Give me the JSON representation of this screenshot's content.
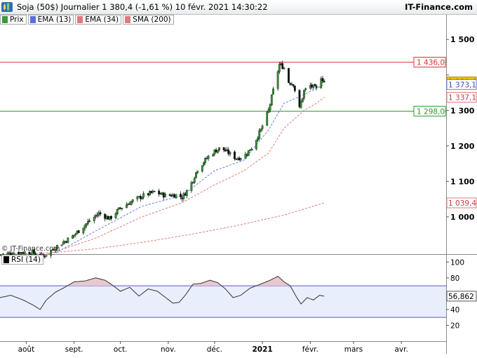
{
  "window": {
    "title": "Soja (50$) Journalier 1 380,4 (-1,61 %) 10 févr. 2021 14:30:22",
    "brand": "IT-Finance.com",
    "copyright": "© IT-Finance.com",
    "logo_icon": "candlestick-logo-icon"
  },
  "legend": [
    {
      "label": "Prix",
      "color": "#3a9a3a"
    },
    {
      "label": "EMA (13)",
      "color": "#5b6ee0"
    },
    {
      "label": "EMA (34)",
      "color": "#e07a7a"
    },
    {
      "label": "SMA (200)",
      "color": "#e07a7a"
    }
  ],
  "rsi_legend": {
    "label": "RSI (14)",
    "color": "#000000"
  },
  "colors": {
    "up": "#2e9a2e",
    "down": "#111111",
    "ema13": "#6a7be8",
    "ema34": "#e07a7a",
    "sma200": "#e07a7a",
    "resistance": "#e03030",
    "support": "#2e9a2e",
    "price_badge": "#f2c200",
    "rsi_fill": "#e9eefc",
    "rsi_over": "#e8c8d0",
    "rsi_line": "#333333"
  },
  "chart_data": [
    {
      "type": "candlestick",
      "title": "Soja (50$) Journalier",
      "x_type": "date",
      "x_tick_labels": [
        "août",
        "sept.",
        "oct.",
        "nov.",
        "déc.",
        "2021",
        "févr.",
        "mars",
        "avr."
      ],
      "x_tick_dates": [
        "2020-08-01",
        "2020-09-01",
        "2020-10-01",
        "2020-11-01",
        "2020-12-01",
        "2021-01-01",
        "2021-02-01",
        "2021-03-01",
        "2021-04-01"
      ],
      "x_range": [
        "2020-07-15",
        "2021-04-30"
      ],
      "ylim": [
        895,
        1540
      ],
      "y_ticks": [
        1000,
        1100,
        1200,
        1300,
        1400,
        1500
      ],
      "y_tick_labels": [
        "1 000",
        "1 100",
        "1 200",
        "1 300",
        "",
        "1 500"
      ],
      "price_path": [
        [
          "2020-07-15",
          893
        ],
        [
          "2020-07-25",
          900
        ],
        [
          "2020-08-05",
          900
        ],
        [
          "2020-08-12",
          888
        ],
        [
          "2020-08-20",
          915
        ],
        [
          "2020-08-31",
          945
        ],
        [
          "2020-09-10",
          985
        ],
        [
          "2020-09-17",
          1010
        ],
        [
          "2020-09-24",
          995
        ],
        [
          "2020-10-01",
          1025
        ],
        [
          "2020-10-09",
          1045
        ],
        [
          "2020-10-16",
          1060
        ],
        [
          "2020-10-23",
          1070
        ],
        [
          "2020-10-30",
          1060
        ],
        [
          "2020-11-06",
          1062
        ],
        [
          "2020-11-10",
          1055
        ],
        [
          "2020-11-15",
          1085
        ],
        [
          "2020-11-20",
          1135
        ],
        [
          "2020-11-27",
          1170
        ],
        [
          "2020-12-01",
          1185
        ],
        [
          "2020-12-05",
          1195
        ],
        [
          "2020-12-10",
          1180
        ],
        [
          "2020-12-15",
          1165
        ],
        [
          "2020-12-20",
          1170
        ],
        [
          "2020-12-25",
          1195
        ],
        [
          "2020-12-31",
          1245
        ],
        [
          "2021-01-05",
          1300
        ],
        [
          "2021-01-09",
          1375
        ],
        [
          "2021-01-12",
          1430
        ],
        [
          "2021-01-15",
          1420
        ],
        [
          "2021-01-18",
          1380
        ],
        [
          "2021-01-21",
          1375
        ],
        [
          "2021-01-25",
          1305
        ],
        [
          "2021-01-28",
          1355
        ],
        [
          "2021-02-01",
          1370
        ],
        [
          "2021-02-05",
          1360
        ],
        [
          "2021-02-08",
          1395
        ],
        [
          "2021-02-10",
          1380
        ]
      ],
      "ema13": [
        [
          "2020-08-20",
          898
        ],
        [
          "2020-09-15",
          960
        ],
        [
          "2020-10-15",
          1030
        ],
        [
          "2020-11-10",
          1060
        ],
        [
          "2020-12-01",
          1130
        ],
        [
          "2020-12-20",
          1160
        ],
        [
          "2021-01-05",
          1245
        ],
        [
          "2021-01-15",
          1320
        ],
        [
          "2021-01-28",
          1345
        ],
        [
          "2021-02-05",
          1362
        ],
        [
          "2021-02-10",
          1373.1
        ]
      ],
      "ema34": [
        [
          "2020-08-15",
          895
        ],
        [
          "2020-09-15",
          940
        ],
        [
          "2020-10-15",
          1000
        ],
        [
          "2020-11-10",
          1040
        ],
        [
          "2020-12-01",
          1090
        ],
        [
          "2020-12-20",
          1130
        ],
        [
          "2021-01-05",
          1180
        ],
        [
          "2021-01-15",
          1250
        ],
        [
          "2021-01-28",
          1300
        ],
        [
          "2021-02-05",
          1320
        ],
        [
          "2021-02-10",
          1337.1
        ]
      ],
      "sma200": [
        [
          "2020-07-20",
          895
        ],
        [
          "2020-08-15",
          898
        ],
        [
          "2020-09-15",
          910
        ],
        [
          "2020-10-15",
          928
        ],
        [
          "2020-11-15",
          950
        ],
        [
          "2020-12-15",
          975
        ],
        [
          "2021-01-15",
          1005
        ],
        [
          "2021-02-10",
          1039.4
        ]
      ],
      "resistance_level": 1436.0,
      "resistance_label": "1 436,0",
      "support_level": 1298.0,
      "support_label": "1 298,0",
      "last_price": 1380.4,
      "last_price_label": "1 380,4",
      "ema13_last_label": "1 373,1",
      "ema34_last_label": "1 337,1",
      "sma200_last_label": "1 039,4"
    },
    {
      "type": "line",
      "title": "RSI (14)",
      "ylim": [
        0,
        110
      ],
      "y_ticks": [
        20,
        40,
        60,
        80,
        100
      ],
      "y_tick_labels": [
        "20",
        "40",
        "",
        "80",
        "100"
      ],
      "overbought": 70,
      "oversold": 30,
      "last_value": 56.862,
      "last_value_label": "56,862",
      "rsi_path": [
        [
          "2020-07-15",
          55
        ],
        [
          "2020-07-22",
          58
        ],
        [
          "2020-07-30",
          52
        ],
        [
          "2020-08-06",
          45
        ],
        [
          "2020-08-10",
          40
        ],
        [
          "2020-08-14",
          52
        ],
        [
          "2020-08-20",
          62
        ],
        [
          "2020-08-26",
          68
        ],
        [
          "2020-09-01",
          75
        ],
        [
          "2020-09-08",
          76
        ],
        [
          "2020-09-15",
          80
        ],
        [
          "2020-09-21",
          77
        ],
        [
          "2020-09-25",
          72
        ],
        [
          "2020-10-01",
          63
        ],
        [
          "2020-10-07",
          68
        ],
        [
          "2020-10-13",
          57
        ],
        [
          "2020-10-19",
          66
        ],
        [
          "2020-10-25",
          63
        ],
        [
          "2020-10-31",
          54
        ],
        [
          "2020-11-04",
          48
        ],
        [
          "2020-11-08",
          49
        ],
        [
          "2020-11-12",
          58
        ],
        [
          "2020-11-17",
          72
        ],
        [
          "2020-11-22",
          73
        ],
        [
          "2020-11-28",
          77
        ],
        [
          "2020-12-03",
          74
        ],
        [
          "2020-12-08",
          66
        ],
        [
          "2020-12-13",
          55
        ],
        [
          "2020-12-18",
          58
        ],
        [
          "2020-12-24",
          67
        ],
        [
          "2021-01-01",
          73
        ],
        [
          "2021-01-06",
          77
        ],
        [
          "2021-01-11",
          82
        ],
        [
          "2021-01-15",
          75
        ],
        [
          "2021-01-19",
          70
        ],
        [
          "2021-01-23",
          56
        ],
        [
          "2021-01-26",
          47
        ],
        [
          "2021-01-30",
          55
        ],
        [
          "2021-02-03",
          52
        ],
        [
          "2021-02-07",
          58
        ],
        [
          "2021-02-10",
          56.862
        ]
      ]
    }
  ]
}
